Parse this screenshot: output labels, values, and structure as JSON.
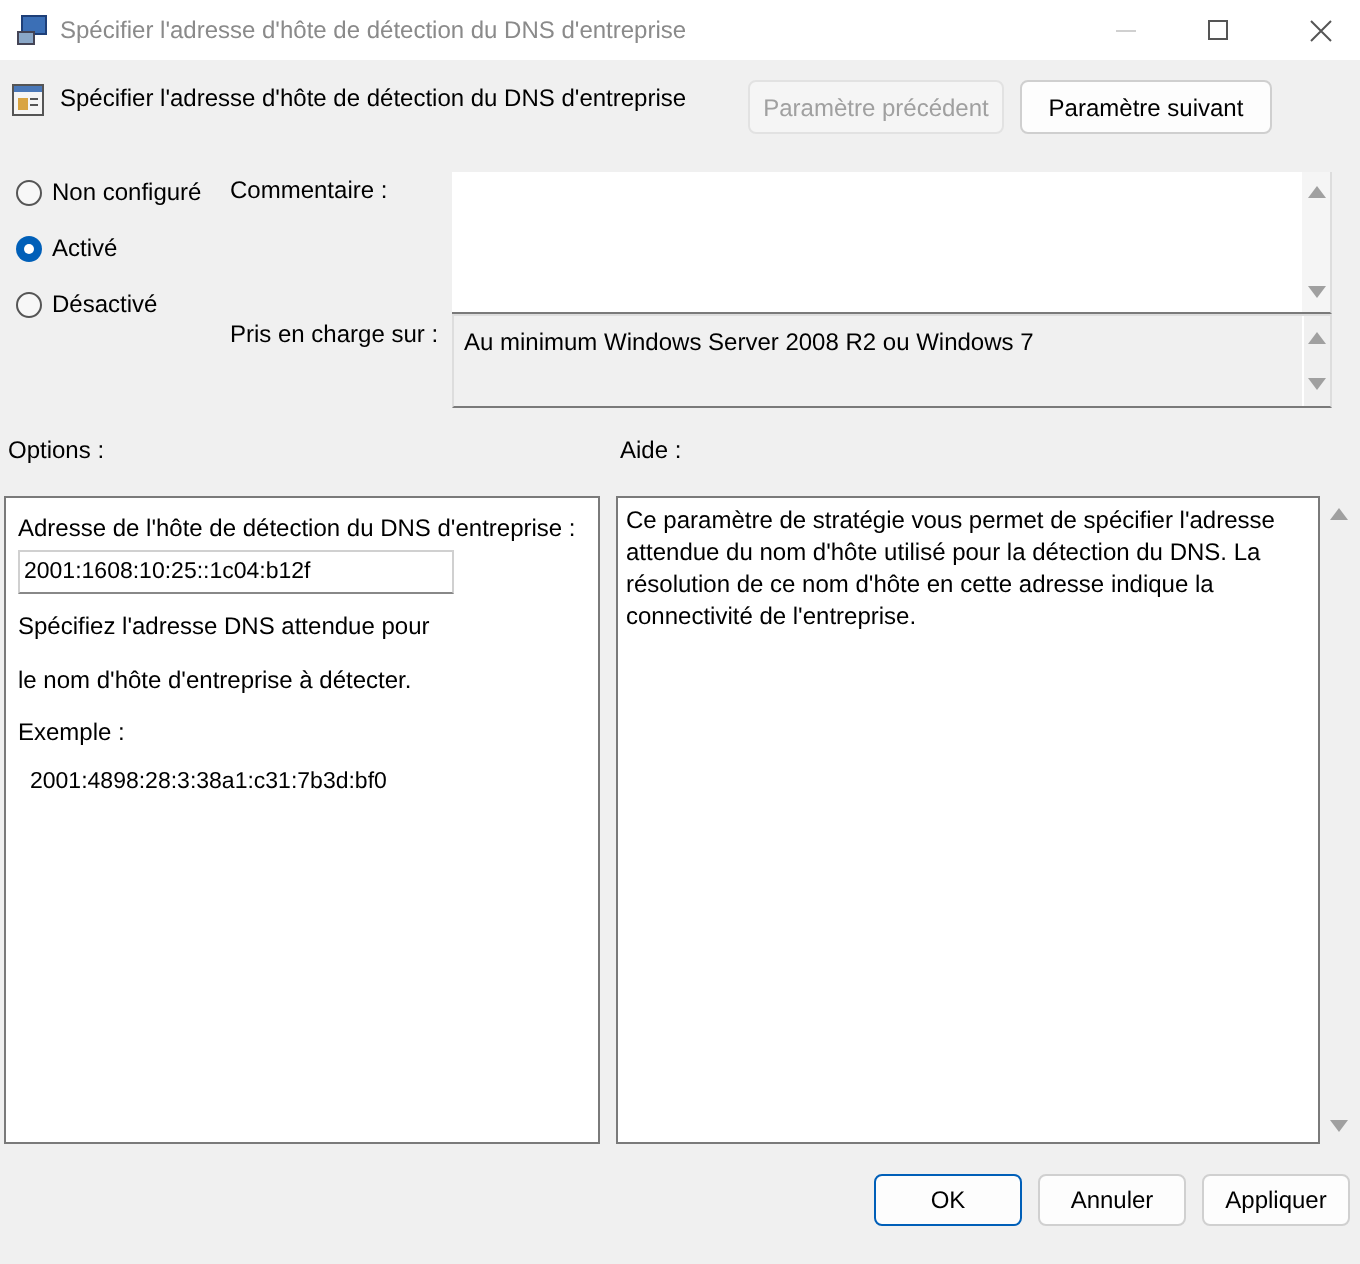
{
  "window": {
    "title": "Spécifier l'adresse d'hôte de détection du DNS d'entreprise"
  },
  "header": {
    "title": "Spécifier l'adresse d'hôte de détection du DNS d'entreprise",
    "buttons": [
      {
        "label": "Paramètre précédent",
        "disabled": true
      },
      {
        "label": "Paramètre suivant",
        "disabled": false
      }
    ]
  },
  "state_options": [
    {
      "label": "Non configuré",
      "selected": false
    },
    {
      "label": "Activé",
      "selected": true
    },
    {
      "label": "Désactivé",
      "selected": false
    }
  ],
  "comment": {
    "label": "Commentaire :"
  },
  "supported_on": {
    "label": "Pris en charge sur :",
    "value": "Au minimum Windows Server 2008 R2 ou Windows 7"
  },
  "options": {
    "label": "Options :",
    "field_label": "Adresse de l'hôte de détection du DNS d'entreprise :",
    "field_value": "2001:1608:10:25::1c04:b12f",
    "description": [
      "Spécifiez l'adresse DNS attendue pour",
      "le nom d'hôte d'entreprise à détecter."
    ],
    "example_label": "Exemple :",
    "example": "2001:4898:28:3:38a1:c31:7b3d:bf0"
  },
  "help": {
    "label": "Aide :",
    "text": "Ce paramètre de stratégie vous permet de spécifier l'adresse attendue du nom d'hôte utilisé pour la détection du DNS. La résolution de ce nom d'hôte en cette adresse indique la connectivité de l'entreprise."
  },
  "footer_buttons": [
    {
      "label": "OK",
      "default": true
    },
    {
      "label": "Annuler",
      "default": false
    },
    {
      "label": "Appliquer",
      "default": false
    }
  ]
}
